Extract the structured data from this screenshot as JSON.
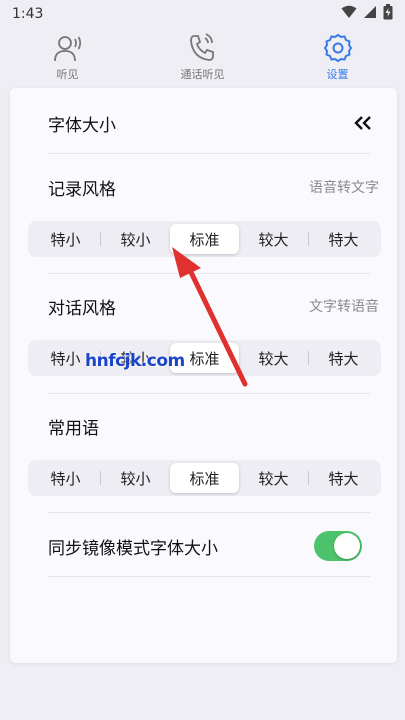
{
  "status": {
    "time": "1:43"
  },
  "tabs": [
    {
      "label": "听见",
      "icon": "person-sound-icon",
      "active": false
    },
    {
      "label": "通话听见",
      "icon": "phone-sound-icon",
      "active": false
    },
    {
      "label": "设置",
      "icon": "gear-icon",
      "active": true
    }
  ],
  "settings": {
    "font_size_title": "字体大小",
    "collapse_icon": "double-chevron-left-icon",
    "sections": [
      {
        "title": "记录风格",
        "subtitle": "语音转文字",
        "options": [
          "特小",
          "较小",
          "标准",
          "较大",
          "特大"
        ],
        "selected": "标准"
      },
      {
        "title": "对话风格",
        "subtitle": "文字转语音",
        "options": [
          "特小",
          "较小",
          "标准",
          "较大",
          "特大"
        ],
        "selected": "标准"
      },
      {
        "title": "常用语",
        "subtitle": "",
        "options": [
          "特小",
          "较小",
          "标准",
          "较大",
          "特大"
        ],
        "selected": "标准"
      }
    ],
    "mirror_sync": {
      "label": "同步镜像模式字体大小",
      "enabled": true
    }
  },
  "overlay": {
    "watermark_text": "hnfcjk.com"
  },
  "colors": {
    "accent": "#3a7be8",
    "toggle_on": "#4cc26a",
    "arrow": "#e0302f",
    "watermark": "#1b44c8"
  }
}
